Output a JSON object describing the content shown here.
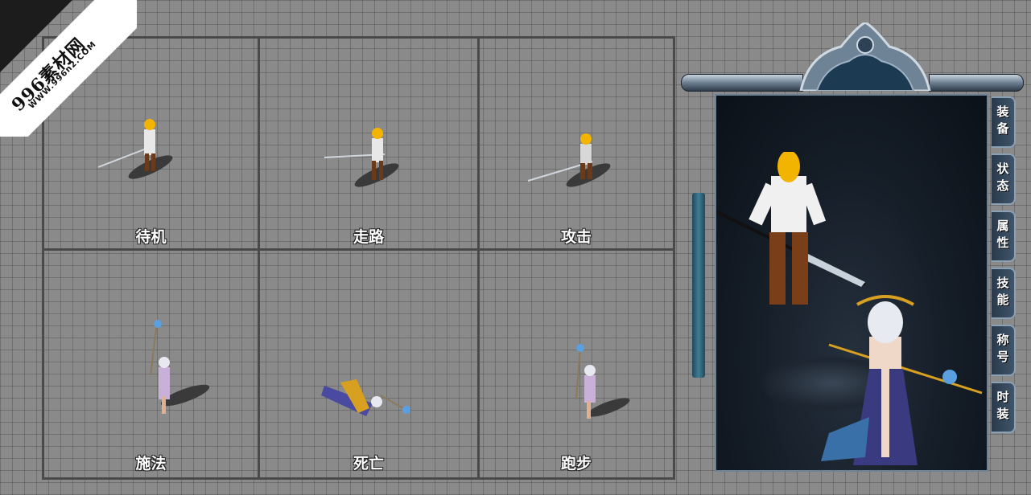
{
  "watermark": {
    "line1": "996素材网",
    "line2": "WWW.996n2.COM"
  },
  "animations": [
    {
      "label": "待机"
    },
    {
      "label": "走路"
    },
    {
      "label": "攻击"
    },
    {
      "label": "施法"
    },
    {
      "label": "死亡"
    },
    {
      "label": "跑步"
    }
  ],
  "character_panel": {
    "tabs": [
      {
        "label": "装备"
      },
      {
        "label": "状态"
      },
      {
        "label": "属性"
      },
      {
        "label": "技能"
      },
      {
        "label": "称号"
      },
      {
        "label": "时装"
      }
    ]
  },
  "colors": {
    "grid_background": "#8a8a8a",
    "grid_line": "#4a4a4a",
    "panel_dark": "#141c26",
    "frame_steel": "#9ab0c2"
  }
}
